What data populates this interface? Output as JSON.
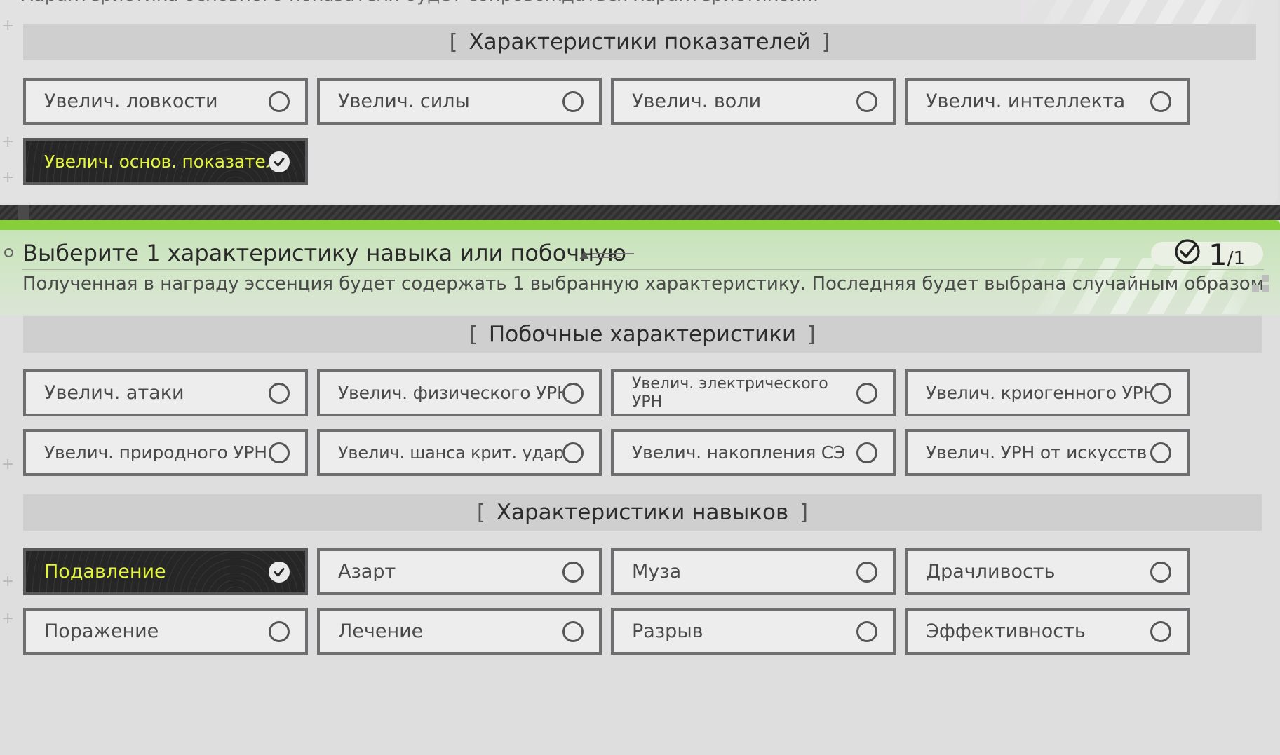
{
  "top_cut_text": "Характеристика основного показателя будет сопровождаться характеристикой...",
  "stat_section": {
    "title": "Характеристики показателей",
    "options": [
      {
        "label": "Увелич. ловкости",
        "selected": false
      },
      {
        "label": "Увелич. силы",
        "selected": false
      },
      {
        "label": "Увелич. воли",
        "selected": false
      },
      {
        "label": "Увелич. интеллекта",
        "selected": false
      },
      {
        "label": "Увелич. основ. показателя",
        "selected": true
      }
    ]
  },
  "quest": {
    "title": "Выберите 1 характеристику навыка или побочную",
    "description": "Полученная в награду эссенция будет содержать 1 выбранную характеристику. Последняя будет выбрана случайным образом.",
    "counter_current": "1",
    "counter_total": "/1"
  },
  "secondary_section": {
    "title": "Побочные характеристики",
    "options": [
      {
        "label": "Увелич. атаки",
        "selected": false
      },
      {
        "label": "Увелич. физического УРН",
        "selected": false
      },
      {
        "label": "Увелич. электрического УРН",
        "selected": false
      },
      {
        "label": "Увелич. криогенного УРН",
        "selected": false
      },
      {
        "label": "Увелич. природного УРН",
        "selected": false
      },
      {
        "label": "Увелич. шанса крит. удара",
        "selected": false
      },
      {
        "label": "Увелич. накопления СЭ",
        "selected": false
      },
      {
        "label": "Увелич. УРН от искусств",
        "selected": false
      }
    ]
  },
  "skill_section": {
    "title": "Характеристики навыков",
    "options": [
      {
        "label": "Подавление",
        "selected": true
      },
      {
        "label": "Азарт",
        "selected": false
      },
      {
        "label": "Муза",
        "selected": false
      },
      {
        "label": "Драчливость",
        "selected": false
      },
      {
        "label": "Поражение",
        "selected": false
      },
      {
        "label": "Лечение",
        "selected": false
      },
      {
        "label": "Разрыв",
        "selected": false
      },
      {
        "label": "Эффективность",
        "selected": false
      }
    ]
  },
  "brackets": {
    "open": "[",
    "close": "]"
  },
  "colors": {
    "accent_green": "#86cf3a",
    "selected_text": "#e4f53b",
    "selected_bg": "#262627"
  }
}
